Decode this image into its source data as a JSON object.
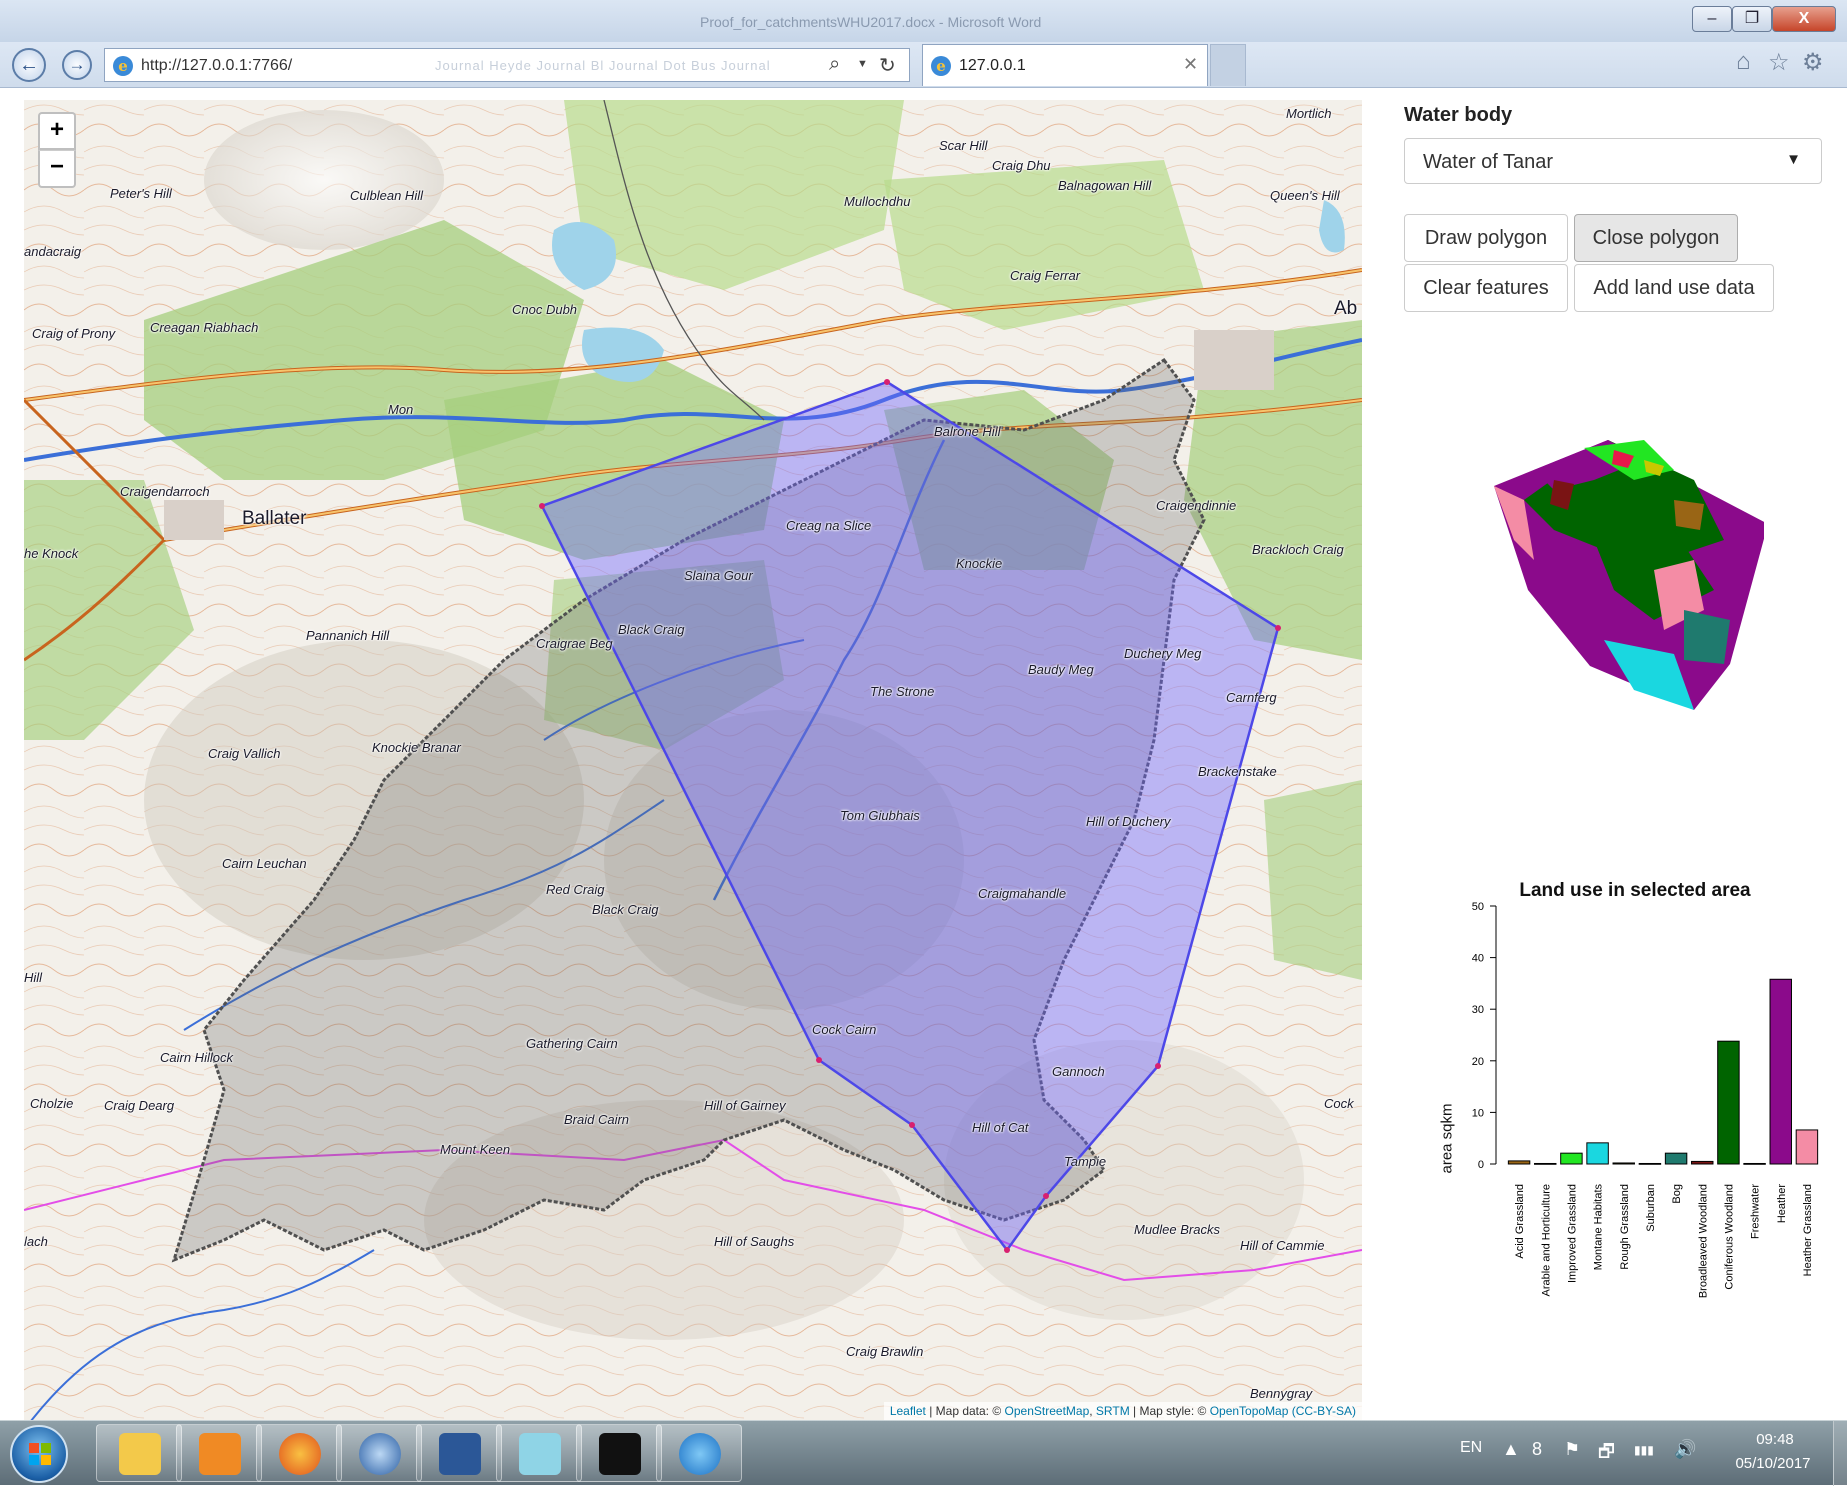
{
  "window": {
    "title": "Proof_for_catchmentsWHU2017.docx - Microsoft Word",
    "min_glyph": "–",
    "max_glyph": "❐",
    "close_glyph": "X"
  },
  "browser": {
    "back_glyph": "←",
    "forward_glyph": "→",
    "favicon_glyph": "e",
    "url": "http://127.0.0.1:7766/",
    "url_ghost": "Journal  Heyde  Journal  Bl  Journal  Dot  Bus  Journal",
    "search_glyph": "⌕",
    "dropdown_glyph": "▼",
    "refresh_glyph": "↻",
    "tab_label": "127.0.0.1",
    "tab_close_glyph": "✕",
    "home_glyph": "⌂",
    "favorites_glyph": "☆",
    "settings_glyph": "⚙"
  },
  "map": {
    "zoom_in_label": "+",
    "zoom_out_label": "−",
    "attribution": {
      "leaflet": "Leaflet",
      "sep1": " | Map data: © ",
      "osm": "OpenStreetMap",
      "sep2": ", ",
      "srtm": "SRTM",
      "sep3": " | Map style: © ",
      "otm": "OpenTopoMap",
      "ccbysa": "(CC-BY-SA)"
    },
    "places": {
      "mortlich": "Mortlich",
      "scar_hill": "Scar Hill",
      "craig_dhu": "Craig Dhu",
      "balnagowan_hill": "Balnagowan Hill",
      "queens_hill": "Queen's Hill",
      "peters_hill": "Peter's Hill",
      "culblean_hill": "Culblean Hill",
      "mullochdhu": "Mullochdhu",
      "andacraig": "andacraig",
      "craig_ferrar": "Craig Ferrar",
      "cnoc_dubh": "Cnoc Dubh",
      "craig_of_prony": "Craig of Prony",
      "creagan_riabhach": "Creagan Riabhach",
      "ab": "Ab",
      "mon": "Mon",
      "balrone_hill": "Balrone Hill",
      "craigendarroch": "Craigendarroch",
      "ballater": "Ballater",
      "craigendinnie": "Craigendinnie",
      "creag_na_slice": "Creag na Slice",
      "the_knock": "he Knock",
      "knockie": "Knockie",
      "brackloch_craig": "Brackloch Craig",
      "slaina_gour": "Slaina Gour",
      "black_craig_1": "Black Craig",
      "pannanich_hill": "Pannanich Hill",
      "craigrae_beg": "Craigrae Beg",
      "duchery_meg": "Duchery Meg",
      "baudy_meg": "Baudy Meg",
      "the_strone": "The Strone",
      "carnferg": "Carnferg",
      "craig_vallich": "Craig Vallich",
      "knockie_branar": "Knockie Branar",
      "brackenstake": "Brackenstake",
      "tom_giubhais": "Tom Giubhais",
      "hill_of_duchery": "Hill of Duchery",
      "cairn_leuchan": "Cairn Leuchan",
      "red_craig": "Red Craig",
      "black_craig_2": "Black Craig",
      "craigmahandle": "Craigmahandle",
      "hill": "Hill",
      "cock_cairn": "Cock Cairn",
      "gathering_cairn": "Gathering Cairn",
      "cairn_hillock": "Cairn Hillock",
      "gannoch": "Gannoch",
      "cholzie": "Cholzie",
      "craig_dearg": "Craig Dearg",
      "braid_cairn": "Braid Cairn",
      "hill_of_gairney": "Hill of Gairney",
      "cock": "Cock",
      "hill_of_cat": "Hill of Cat",
      "mount_keen": "Mount Keen",
      "tampie": "Tampie",
      "mudlee_bracks": "Mudlee Bracks",
      "hill_of_cammie": "Hill of Cammie",
      "lach": "lach",
      "hill_of_saughs": "Hill of Saughs",
      "craig_brawlin": "Craig Brawlin",
      "bennygray": "Bennygray"
    }
  },
  "panel": {
    "water_body_label": "Water body",
    "water_body_value": "Water of Tanar",
    "caret_glyph": "▼",
    "buttons": {
      "draw_polygon": "Draw polygon",
      "close_polygon": "Close polygon",
      "clear_features": "Clear features",
      "add_land_use": "Add land use data"
    }
  },
  "chart_data": {
    "type": "bar",
    "title": "Land use in selected area",
    "xlabel": "",
    "ylabel": "area sqkm",
    "ylim": [
      0,
      50
    ],
    "yticks": [
      0,
      10,
      20,
      30,
      40,
      50
    ],
    "categories": [
      "Acid Grassland",
      "Arable and Horticulture",
      "Improved Grassland",
      "Montane Habitats",
      "Rough Grassland",
      "Suburban",
      "Bog",
      "Broadleaved Woodland",
      "Coniferous Woodland",
      "Freshwater",
      "Heather",
      "Heather Grassland"
    ],
    "values": [
      0.6,
      0.1,
      2.1,
      4.1,
      0.2,
      0.1,
      2.1,
      0.5,
      23.8,
      0.1,
      35.8,
      6.6
    ],
    "colors": [
      "#996515",
      "#e6194b",
      "#22e622",
      "#1ad7e0",
      "#c8c800",
      "#333333",
      "#1f7a6e",
      "#7a1414",
      "#006400",
      "#1e2cd0",
      "#8b0a8b",
      "#f48ca5"
    ]
  },
  "taskbar": {
    "language": "EN",
    "tray_up": "▲",
    "tray_net": "8",
    "tray_flag": "⚑",
    "tray_power": "🗗",
    "tray_signal": "▮▮▮",
    "tray_volume": "🔊",
    "time": "09:48",
    "date": "05/10/2017",
    "apps": [
      "explorer",
      "outlook",
      "firefox",
      "thunderbird",
      "word",
      "notepad",
      "cmd",
      "ie"
    ]
  }
}
